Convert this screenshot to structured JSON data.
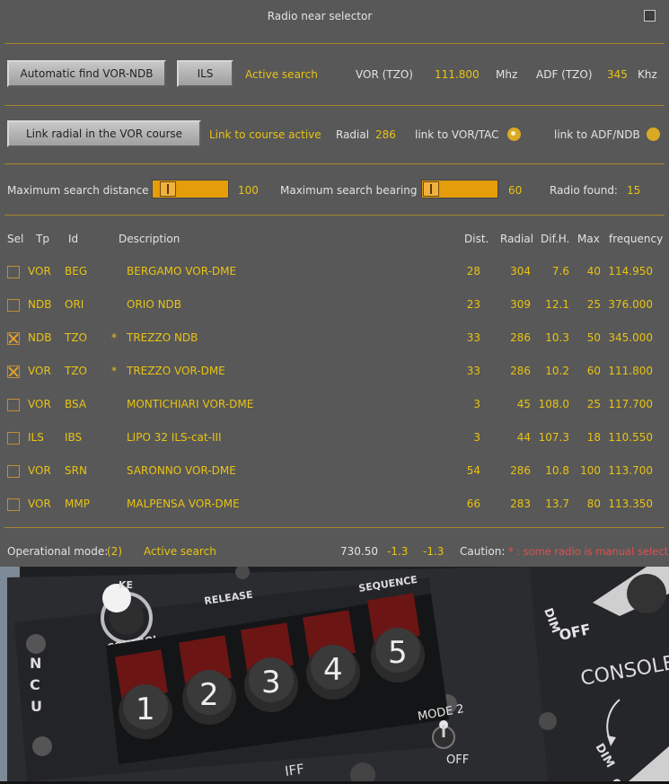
{
  "window": {
    "title": "Radio near selector"
  },
  "search": {
    "auto_button": "Automatic find VOR-NDB",
    "ils_button": "ILS",
    "status": "Active search",
    "vor_label": "VOR (TZO)",
    "vor_freq": "111.800",
    "vor_unit": "Mhz",
    "adf_label": "ADF (TZO)",
    "adf_freq": "345",
    "adf_unit": "Khz"
  },
  "link": {
    "button": "Link radial in the VOR course",
    "status": "Link to course active",
    "radial_label": "Radial",
    "radial_value": "286",
    "vor_tac_label": "link to VOR/TAC",
    "adf_ndb_label": "link to ADF/NDB",
    "selected": "VOR/TAC"
  },
  "limits": {
    "distance_label": "Maximum search distance",
    "distance_value": "100",
    "distance_fraction": 0.12,
    "bearing_label": "Maximum search bearing",
    "bearing_value": "60",
    "bearing_fraction": 0.12,
    "found_label": "Radio found:",
    "found_value": "15"
  },
  "table": {
    "headers": [
      "Sel",
      "Tp",
      "Id",
      "Description",
      "Dist.",
      "Radial",
      "Dif.H.",
      "Max",
      "frequency"
    ],
    "rows": [
      {
        "sel": false,
        "tp": "VOR",
        "id": "BEG",
        "manual": "",
        "desc": "BERGAMO VOR-DME",
        "dist": "28",
        "radial": "304",
        "difh": "7.6",
        "max": "40",
        "freq": "114.950"
      },
      {
        "sel": false,
        "tp": "NDB",
        "id": "ORI",
        "manual": "",
        "desc": "ORIO NDB",
        "dist": "23",
        "radial": "309",
        "difh": "12.1",
        "max": "25",
        "freq": "376.000"
      },
      {
        "sel": true,
        "tp": "NDB",
        "id": "TZO",
        "manual": "*",
        "desc": "TREZZO NDB",
        "dist": "33",
        "radial": "286",
        "difh": "10.3",
        "max": "50",
        "freq": "345.000"
      },
      {
        "sel": true,
        "tp": "VOR",
        "id": "TZO",
        "manual": "*",
        "desc": "TREZZO VOR-DME",
        "dist": "33",
        "radial": "286",
        "difh": "10.2",
        "max": "60",
        "freq": "111.800"
      },
      {
        "sel": false,
        "tp": "VOR",
        "id": "BSA",
        "manual": "",
        "desc": "MONTICHIARI VOR-DME",
        "dist": "3",
        "radial": "45",
        "difh": "108.0",
        "max": "25",
        "freq": "117.700"
      },
      {
        "sel": false,
        "tp": "ILS",
        "id": "IBS",
        "manual": "",
        "desc": "LIPO 32 ILS-cat-III",
        "dist": "3",
        "radial": "44",
        "difh": "107.3",
        "max": "18",
        "freq": "110.550"
      },
      {
        "sel": false,
        "tp": "VOR",
        "id": "SRN",
        "manual": "",
        "desc": "SARONNO VOR-DME",
        "dist": "54",
        "radial": "286",
        "difh": "10.8",
        "max": "100",
        "freq": "113.700"
      },
      {
        "sel": false,
        "tp": "VOR",
        "id": "MMP",
        "manual": "",
        "desc": "MALPENSA VOR-DME",
        "dist": "66",
        "radial": "283",
        "difh": "13.7",
        "max": "80",
        "freq": "113.350"
      }
    ]
  },
  "footer": {
    "mode_label": "Operational mode:",
    "mode_value": "(2)",
    "mode_status": "Active search",
    "value1": "730.50",
    "value2": "-1.3",
    "value3": "-1.3",
    "caution_label": "Caution:",
    "caution_star": "*",
    "caution_text": ": some radio is manual select"
  },
  "cockpit": {
    "labels": {
      "control_a": "KE",
      "control_b": "CONTROL",
      "release": "RELEASE",
      "sequence": "SEQUENCE",
      "ncu": "NCU",
      "dim": "DIM",
      "off": "OFF",
      "console": "CONSOLE",
      "mode2": "MODE 2",
      "off2": "OFF",
      "iff": "IFF",
      "dim2": "DIM",
      "off3": "OF"
    },
    "release_buttons": [
      "1",
      "2",
      "3",
      "4",
      "5"
    ]
  }
}
